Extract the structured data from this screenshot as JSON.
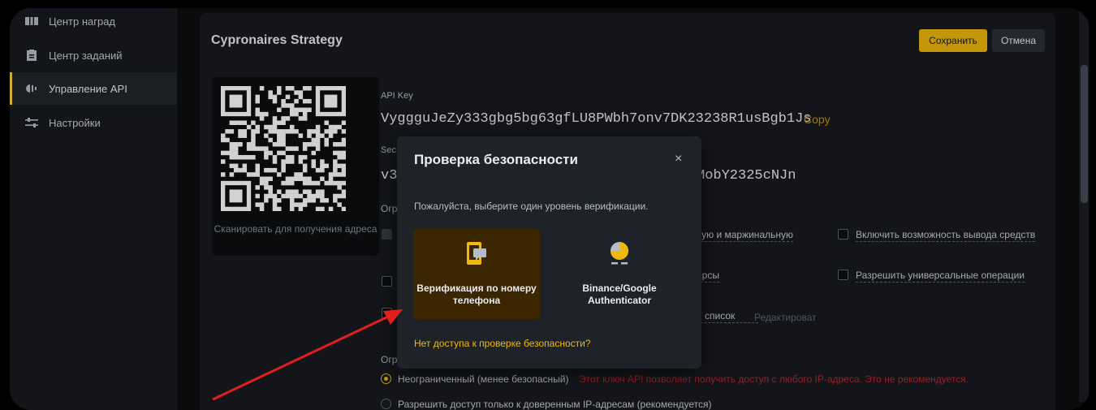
{
  "sidebar": {
    "items": [
      {
        "label": "Центр наград",
        "icon": "ticket-icon",
        "active": false
      },
      {
        "label": "Центр заданий",
        "icon": "clipboard-icon",
        "active": false
      },
      {
        "label": "Управление API",
        "icon": "api-icon",
        "active": true
      },
      {
        "label": "Настройки",
        "icon": "sliders-icon",
        "active": false
      }
    ]
  },
  "header": {
    "title": "Cypronaires Strategy",
    "save_label": "Сохранить",
    "cancel_label": "Отмена"
  },
  "qr": {
    "caption": "Сканировать для получения адреса"
  },
  "api": {
    "key_label": "API Key",
    "key_value": "VyggguJeZy333gbg5bg63gfLU8PWbh7onv7DK23238R1usBgb1Js",
    "copy_label": "Copy",
    "secret_label_visible": "Sec",
    "secret_value_start": "v3",
    "secret_value_end": "MobY2325cNJn",
    "restrictions_label_visible": "Огр"
  },
  "permissions": {
    "margin_partial": "вую и маржинальную",
    "futures_partial": "ерсы",
    "whitelist_partial": "й список",
    "edit_partial": "Редактироват",
    "withdraw": "Включить возможность вывода средств",
    "universal": "Разрешить универсальные операции"
  },
  "ip_access": {
    "label_visible": "Огр",
    "unrestricted": "Неограниченный (менее безопасный)",
    "warning": "Этот ключ API позволяет получить доступ с любого IP-адреса. Это не рекомендуется.",
    "restricted": "Разрешить доступ только к доверенным IP-адресам (рекомендуется)"
  },
  "modal": {
    "title": "Проверка безопасности",
    "close": "×",
    "description": "Пожалуйста, выберите один уровень верификации.",
    "options": [
      {
        "label": "Верификация по номеру телефона",
        "icon": "phone-sms-icon",
        "selected": true
      },
      {
        "label": "Binance/Google Authenticator",
        "icon": "authenticator-icon",
        "selected": false
      }
    ],
    "help_link": "Нет доступа к проверке безопасности?"
  },
  "colors": {
    "accent": "#f0b90b",
    "warning": "#b2292e",
    "arrow": "#e11d1d"
  }
}
